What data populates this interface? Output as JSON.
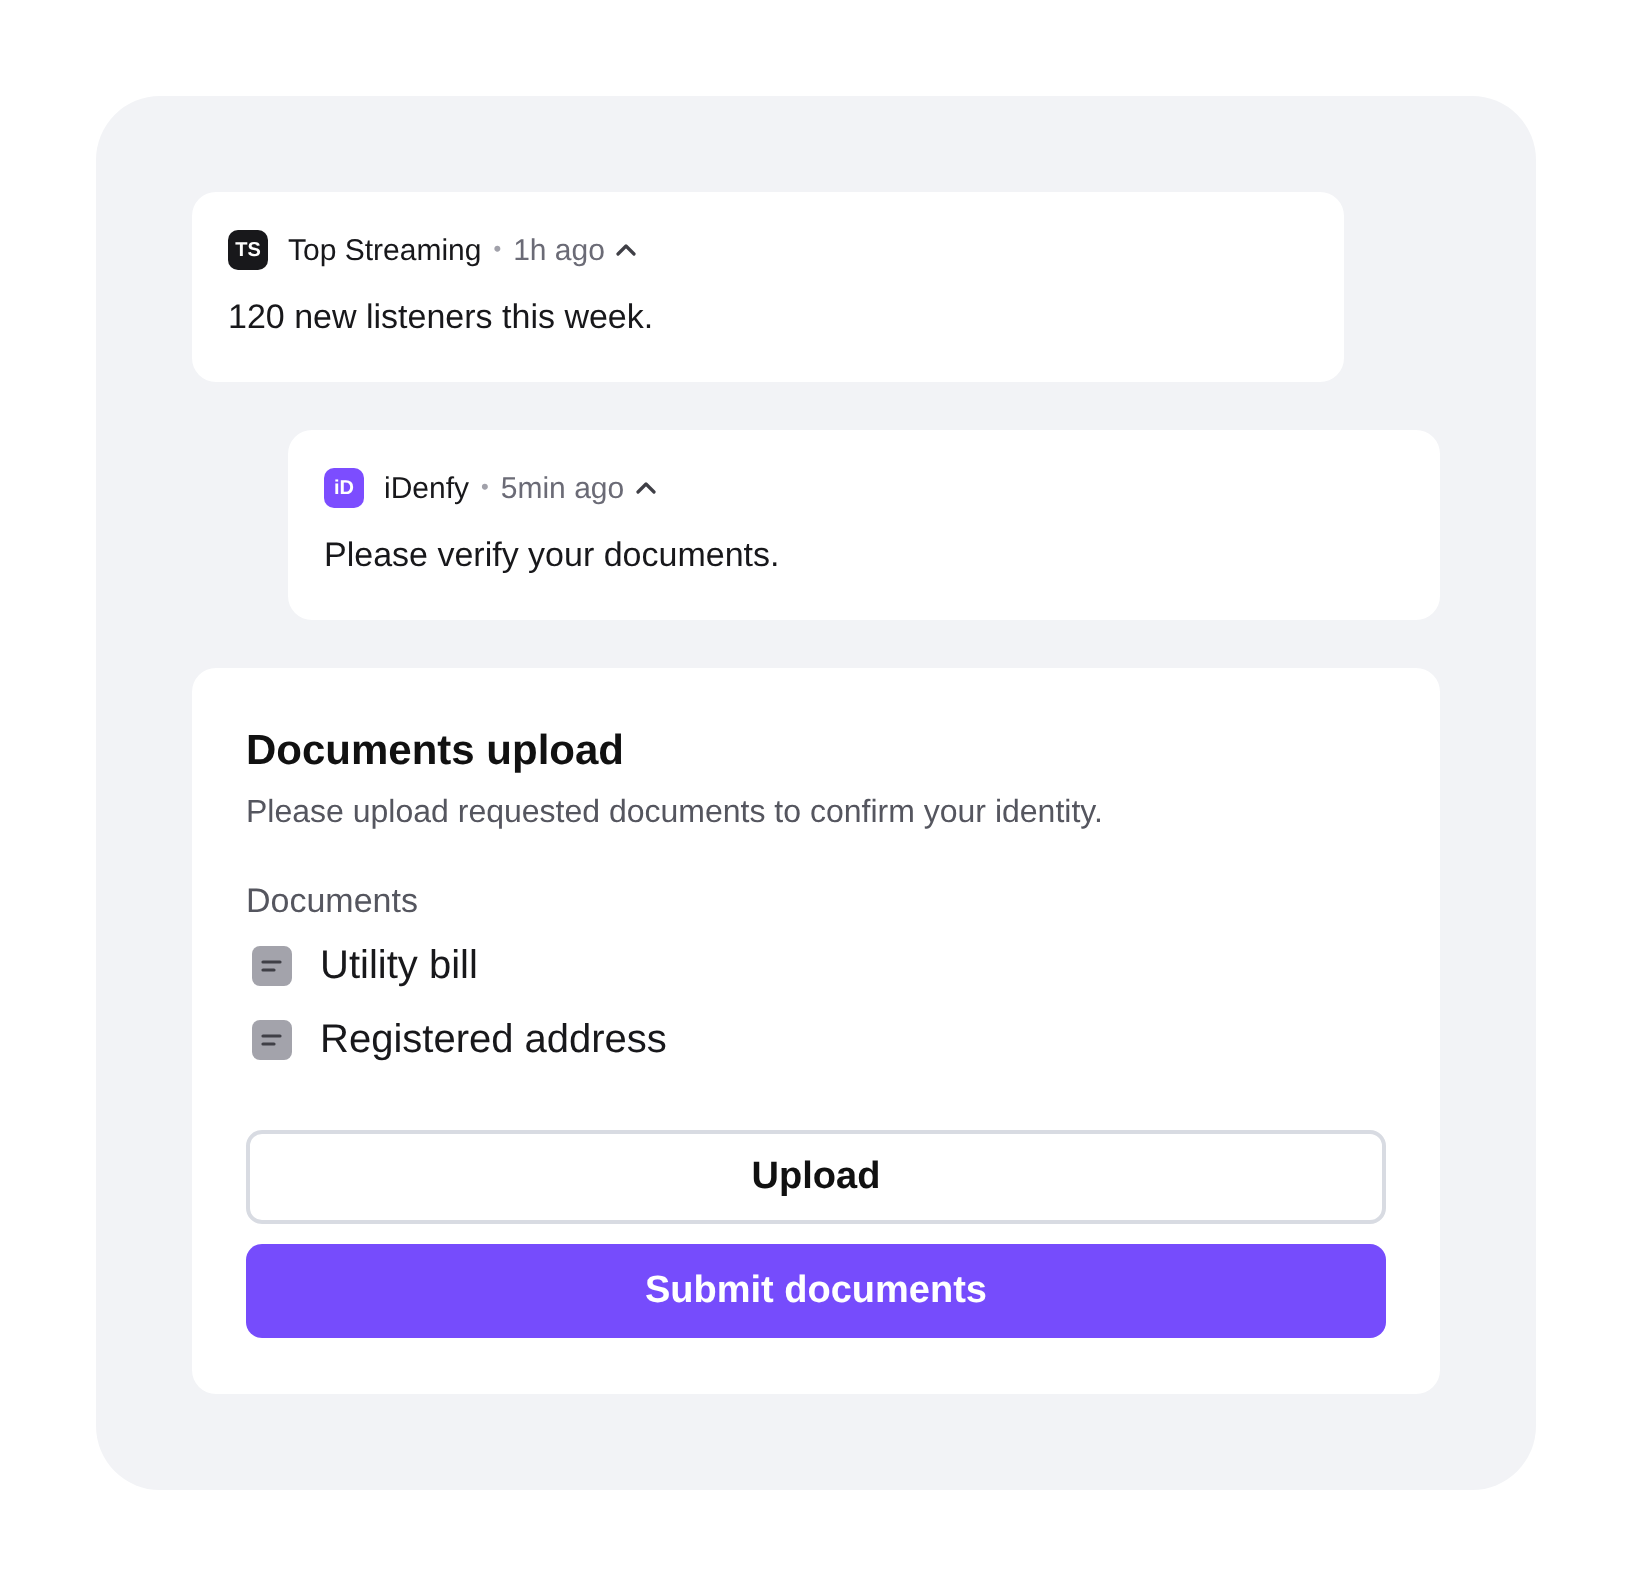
{
  "notifications": [
    {
      "app_logo": "TS",
      "color": "#18181b",
      "app": "Top Streaming",
      "separator": "•",
      "time": "1h ago",
      "expanded": true,
      "message": "120 new listeners this week."
    },
    {
      "app_logo": "iD",
      "color": "#7c4dff",
      "app": "iDenfy",
      "separator": "•",
      "time": "5min ago",
      "expanded": true,
      "message": "Please verify your documents."
    }
  ],
  "upload_card": {
    "title": "Documents upload",
    "description": "Please upload requested documents to confirm your identity.",
    "documents_label": "Documents",
    "documents": [
      "Utility bill",
      "Registered address"
    ],
    "buttons": [
      {
        "label": "Upload",
        "kind": "secondary"
      },
      {
        "label": "Submit documents",
        "kind": "primary"
      }
    ]
  }
}
